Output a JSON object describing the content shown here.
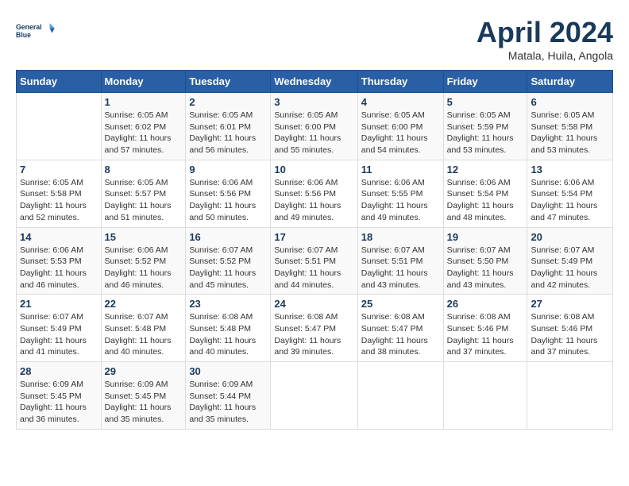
{
  "header": {
    "logo_line1": "General",
    "logo_line2": "Blue",
    "month_year": "April 2024",
    "location": "Matala, Huila, Angola"
  },
  "days_of_week": [
    "Sunday",
    "Monday",
    "Tuesday",
    "Wednesday",
    "Thursday",
    "Friday",
    "Saturday"
  ],
  "weeks": [
    [
      {
        "day": "",
        "sunrise": "",
        "sunset": "",
        "daylight": ""
      },
      {
        "day": "1",
        "sunrise": "Sunrise: 6:05 AM",
        "sunset": "Sunset: 6:02 PM",
        "daylight": "Daylight: 11 hours and 57 minutes."
      },
      {
        "day": "2",
        "sunrise": "Sunrise: 6:05 AM",
        "sunset": "Sunset: 6:01 PM",
        "daylight": "Daylight: 11 hours and 56 minutes."
      },
      {
        "day": "3",
        "sunrise": "Sunrise: 6:05 AM",
        "sunset": "Sunset: 6:00 PM",
        "daylight": "Daylight: 11 hours and 55 minutes."
      },
      {
        "day": "4",
        "sunrise": "Sunrise: 6:05 AM",
        "sunset": "Sunset: 6:00 PM",
        "daylight": "Daylight: 11 hours and 54 minutes."
      },
      {
        "day": "5",
        "sunrise": "Sunrise: 6:05 AM",
        "sunset": "Sunset: 5:59 PM",
        "daylight": "Daylight: 11 hours and 53 minutes."
      },
      {
        "day": "6",
        "sunrise": "Sunrise: 6:05 AM",
        "sunset": "Sunset: 5:58 PM",
        "daylight": "Daylight: 11 hours and 53 minutes."
      }
    ],
    [
      {
        "day": "7",
        "sunrise": "Sunrise: 6:05 AM",
        "sunset": "Sunset: 5:58 PM",
        "daylight": "Daylight: 11 hours and 52 minutes."
      },
      {
        "day": "8",
        "sunrise": "Sunrise: 6:05 AM",
        "sunset": "Sunset: 5:57 PM",
        "daylight": "Daylight: 11 hours and 51 minutes."
      },
      {
        "day": "9",
        "sunrise": "Sunrise: 6:06 AM",
        "sunset": "Sunset: 5:56 PM",
        "daylight": "Daylight: 11 hours and 50 minutes."
      },
      {
        "day": "10",
        "sunrise": "Sunrise: 6:06 AM",
        "sunset": "Sunset: 5:56 PM",
        "daylight": "Daylight: 11 hours and 49 minutes."
      },
      {
        "day": "11",
        "sunrise": "Sunrise: 6:06 AM",
        "sunset": "Sunset: 5:55 PM",
        "daylight": "Daylight: 11 hours and 49 minutes."
      },
      {
        "day": "12",
        "sunrise": "Sunrise: 6:06 AM",
        "sunset": "Sunset: 5:54 PM",
        "daylight": "Daylight: 11 hours and 48 minutes."
      },
      {
        "day": "13",
        "sunrise": "Sunrise: 6:06 AM",
        "sunset": "Sunset: 5:54 PM",
        "daylight": "Daylight: 11 hours and 47 minutes."
      }
    ],
    [
      {
        "day": "14",
        "sunrise": "Sunrise: 6:06 AM",
        "sunset": "Sunset: 5:53 PM",
        "daylight": "Daylight: 11 hours and 46 minutes."
      },
      {
        "day": "15",
        "sunrise": "Sunrise: 6:06 AM",
        "sunset": "Sunset: 5:52 PM",
        "daylight": "Daylight: 11 hours and 46 minutes."
      },
      {
        "day": "16",
        "sunrise": "Sunrise: 6:07 AM",
        "sunset": "Sunset: 5:52 PM",
        "daylight": "Daylight: 11 hours and 45 minutes."
      },
      {
        "day": "17",
        "sunrise": "Sunrise: 6:07 AM",
        "sunset": "Sunset: 5:51 PM",
        "daylight": "Daylight: 11 hours and 44 minutes."
      },
      {
        "day": "18",
        "sunrise": "Sunrise: 6:07 AM",
        "sunset": "Sunset: 5:51 PM",
        "daylight": "Daylight: 11 hours and 43 minutes."
      },
      {
        "day": "19",
        "sunrise": "Sunrise: 6:07 AM",
        "sunset": "Sunset: 5:50 PM",
        "daylight": "Daylight: 11 hours and 43 minutes."
      },
      {
        "day": "20",
        "sunrise": "Sunrise: 6:07 AM",
        "sunset": "Sunset: 5:49 PM",
        "daylight": "Daylight: 11 hours and 42 minutes."
      }
    ],
    [
      {
        "day": "21",
        "sunrise": "Sunrise: 6:07 AM",
        "sunset": "Sunset: 5:49 PM",
        "daylight": "Daylight: 11 hours and 41 minutes."
      },
      {
        "day": "22",
        "sunrise": "Sunrise: 6:07 AM",
        "sunset": "Sunset: 5:48 PM",
        "daylight": "Daylight: 11 hours and 40 minutes."
      },
      {
        "day": "23",
        "sunrise": "Sunrise: 6:08 AM",
        "sunset": "Sunset: 5:48 PM",
        "daylight": "Daylight: 11 hours and 40 minutes."
      },
      {
        "day": "24",
        "sunrise": "Sunrise: 6:08 AM",
        "sunset": "Sunset: 5:47 PM",
        "daylight": "Daylight: 11 hours and 39 minutes."
      },
      {
        "day": "25",
        "sunrise": "Sunrise: 6:08 AM",
        "sunset": "Sunset: 5:47 PM",
        "daylight": "Daylight: 11 hours and 38 minutes."
      },
      {
        "day": "26",
        "sunrise": "Sunrise: 6:08 AM",
        "sunset": "Sunset: 5:46 PM",
        "daylight": "Daylight: 11 hours and 37 minutes."
      },
      {
        "day": "27",
        "sunrise": "Sunrise: 6:08 AM",
        "sunset": "Sunset: 5:46 PM",
        "daylight": "Daylight: 11 hours and 37 minutes."
      }
    ],
    [
      {
        "day": "28",
        "sunrise": "Sunrise: 6:09 AM",
        "sunset": "Sunset: 5:45 PM",
        "daylight": "Daylight: 11 hours and 36 minutes."
      },
      {
        "day": "29",
        "sunrise": "Sunrise: 6:09 AM",
        "sunset": "Sunset: 5:45 PM",
        "daylight": "Daylight: 11 hours and 35 minutes."
      },
      {
        "day": "30",
        "sunrise": "Sunrise: 6:09 AM",
        "sunset": "Sunset: 5:44 PM",
        "daylight": "Daylight: 11 hours and 35 minutes."
      },
      {
        "day": "",
        "sunrise": "",
        "sunset": "",
        "daylight": ""
      },
      {
        "day": "",
        "sunrise": "",
        "sunset": "",
        "daylight": ""
      },
      {
        "day": "",
        "sunrise": "",
        "sunset": "",
        "daylight": ""
      },
      {
        "day": "",
        "sunrise": "",
        "sunset": "",
        "daylight": ""
      }
    ]
  ]
}
